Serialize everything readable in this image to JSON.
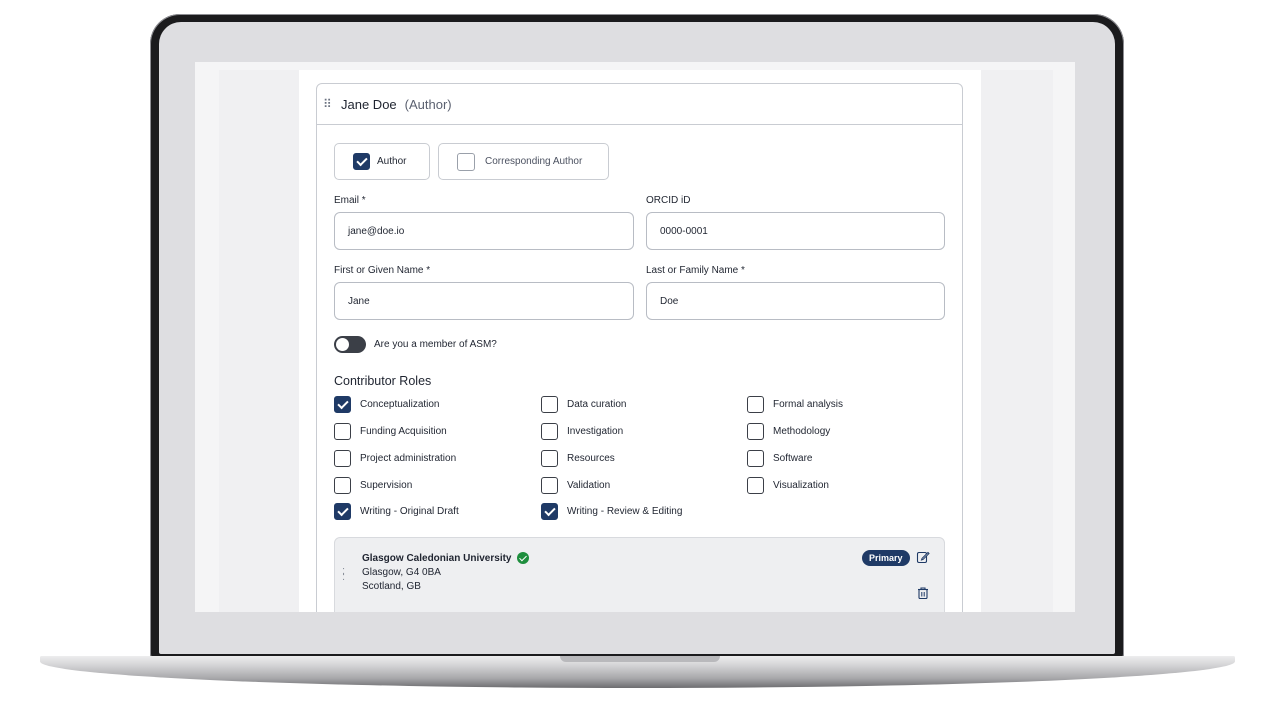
{
  "author_card": {
    "name": "Jane Doe",
    "role_label": "(Author)",
    "chips": {
      "author": {
        "label": "Author",
        "checked": true
      },
      "corresponding": {
        "label": "Corresponding Author",
        "checked": false
      }
    },
    "fields": {
      "email": {
        "label": "Email *",
        "value": "jane@doe.io"
      },
      "orcid": {
        "label": "ORCID iD",
        "value": "0000-0001"
      },
      "first_name": {
        "label": "First or Given Name *",
        "value": "Jane"
      },
      "last_name": {
        "label": "Last or Family Name *",
        "value": "Doe"
      }
    },
    "asm_toggle": {
      "label": "Are you a member of ASM?",
      "on": false
    },
    "contributor_roles": {
      "title": "Contributor Roles",
      "items": [
        {
          "label": "Conceptualization",
          "checked": true
        },
        {
          "label": "Data curation",
          "checked": false
        },
        {
          "label": "Formal analysis",
          "checked": false
        },
        {
          "label": "Funding Acquisition",
          "checked": false
        },
        {
          "label": "Investigation",
          "checked": false
        },
        {
          "label": "Methodology",
          "checked": false
        },
        {
          "label": "Project administration",
          "checked": false
        },
        {
          "label": "Resources",
          "checked": false
        },
        {
          "label": "Software",
          "checked": false
        },
        {
          "label": "Supervision",
          "checked": false
        },
        {
          "label": "Validation",
          "checked": false
        },
        {
          "label": "Visualization",
          "checked": false
        },
        {
          "label": "Writing - Original Draft",
          "checked": true
        },
        {
          "label": "Writing - Review & Editing",
          "checked": true
        }
      ]
    },
    "affiliation": {
      "name": "Glasgow Caledonian University",
      "line1": "Glasgow, G4 0BA",
      "line2": "Scotland, GB",
      "badge": "Primary",
      "verified": true
    }
  },
  "colors": {
    "accent": "#1f3a66",
    "verified_green": "#1e8e3e",
    "border": "#c9ccd2"
  },
  "icons": [
    "drag-handle-icon",
    "check-icon",
    "verified-icon",
    "edit-icon",
    "trash-icon"
  ]
}
